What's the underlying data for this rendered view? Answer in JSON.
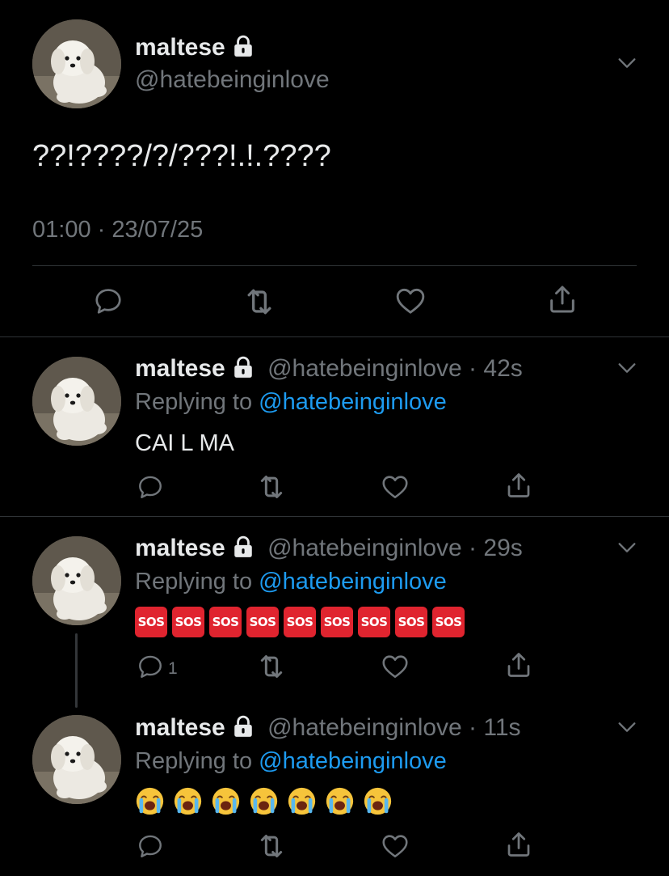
{
  "main": {
    "name": "maltese",
    "handle": "@hatebeinginlove",
    "text": "??!????/?/???!.!.????",
    "timestamp": "01:00 · 23/07/25"
  },
  "replies": [
    {
      "name": "maltese",
      "meta": "@hatebeinginlove · 42s",
      "replying_prefix": "Replying to ",
      "replying_handle": "@hatebeinginlove",
      "text": "CAI L MA",
      "reply_count": ""
    },
    {
      "name": "maltese",
      "meta": "@hatebeinginlove · 29s",
      "replying_prefix": "Replying to ",
      "replying_handle": "@hatebeinginlove",
      "emoji": "sos",
      "emoji_count": 9,
      "sos_label": "SOS",
      "reply_count": "1"
    },
    {
      "name": "maltese",
      "meta": "@hatebeinginlove · 11s",
      "replying_prefix": "Replying to ",
      "replying_handle": "@hatebeinginlove",
      "emoji": "loudly-crying-face",
      "emoji_count": 7,
      "reply_count": ""
    }
  ],
  "colors": {
    "background": "#000000",
    "text": "#e7e9ea",
    "muted": "#71767b",
    "link": "#1d9bf0",
    "sos": "#e0242f"
  }
}
